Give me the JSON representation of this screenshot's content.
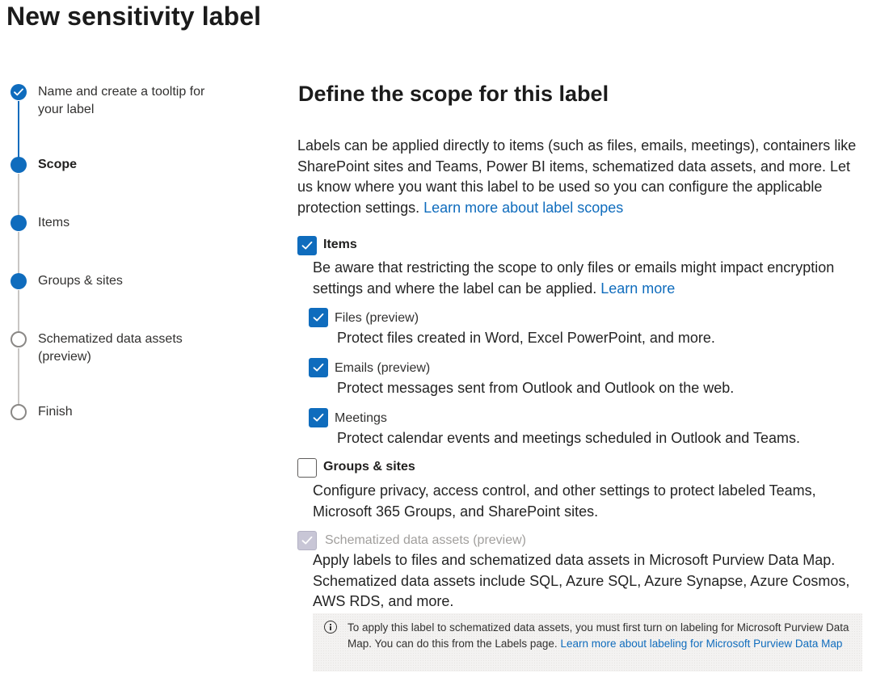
{
  "page": {
    "title": "New sensitivity label"
  },
  "steps": [
    {
      "label": "Name and create a tooltip for your label",
      "state": "completed"
    },
    {
      "label": "Scope",
      "state": "current"
    },
    {
      "label": "Items",
      "state": "upcoming-filled"
    },
    {
      "label": "Groups & sites",
      "state": "upcoming-filled"
    },
    {
      "label": "Schematized data assets (preview)",
      "state": "upcoming"
    },
    {
      "label": "Finish",
      "state": "upcoming"
    }
  ],
  "main": {
    "title": "Define the scope for this label",
    "intro": "Labels can be applied directly to items (such as files, emails, meetings), containers like SharePoint sites and Teams, Power BI items, schematized data assets, and more. Let us know where you want this label to be used so you can configure the applicable protection settings.",
    "intro_link": "Learn more about label scopes",
    "items": {
      "label": "Items",
      "checked": true,
      "description": "Be aware that restricting the scope to only files or emails might impact encryption settings and where the label can be applied.",
      "description_link": "Learn more",
      "sub_options": [
        {
          "label": "Files (preview)",
          "checked": true,
          "description": "Protect files created in Word, Excel PowerPoint, and more."
        },
        {
          "label": "Emails (preview)",
          "checked": true,
          "description": "Protect messages sent from Outlook and Outlook on the web."
        },
        {
          "label": "Meetings",
          "checked": true,
          "description": "Protect calendar events and meetings scheduled in Outlook and Teams."
        }
      ]
    },
    "groups_sites": {
      "label": "Groups & sites",
      "checked": false,
      "description": "Configure privacy, access control, and other settings to protect labeled Teams, Microsoft 365 Groups, and SharePoint sites."
    },
    "schematized": {
      "label": "Schematized data assets (preview)",
      "checked": true,
      "disabled": true,
      "description": "Apply labels to files and schematized data assets in Microsoft Purview Data Map. Schematized data assets include SQL, Azure SQL, Azure Synapse, Azure Cosmos, AWS RDS, and more."
    },
    "info": {
      "text": "To apply this label to schematized data assets, you must first turn on labeling for Microsoft Purview Data Map. You can do this from the Labels page.",
      "link": "Learn more about labeling for Microsoft Purview Data Map"
    }
  },
  "colors": {
    "accent": "#0f6cbd",
    "step_line_inactive": "#c8c6c4",
    "disabled_text": "#a19f9d"
  }
}
